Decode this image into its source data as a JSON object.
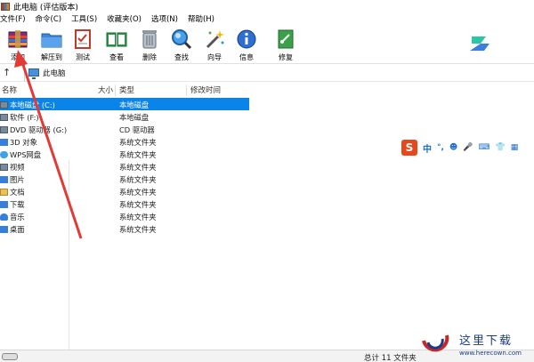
{
  "window": {
    "title": "此电脑 (评估版本)"
  },
  "menu": [
    "文件(F)",
    "命令(C)",
    "工具(S)",
    "收藏夹(O)",
    "选项(N)",
    "帮助(H)"
  ],
  "toolbar": {
    "add": "添加",
    "extract": "解压到",
    "test": "测试",
    "view": "查看",
    "delete": "删除",
    "find": "查找",
    "wizard": "向导",
    "info": "信息",
    "repair": "修复"
  },
  "address": {
    "path": "此电脑"
  },
  "columns": {
    "name": "名称",
    "size": "大小",
    "type": "类型",
    "modified": "修改时间"
  },
  "rows": [
    {
      "name": "本地磁盘 (C:)",
      "type": "本地磁盘",
      "icon": "drive-icon"
    },
    {
      "name": "软件 (F:)",
      "type": "本地磁盘",
      "icon": "drive-icon"
    },
    {
      "name": "DVD 驱动器 (G:)",
      "type": "CD 驱动器",
      "icon": "dvd-drive-icon"
    },
    {
      "name": "3D 对象",
      "type": "系统文件夹",
      "icon": "3d-objects-icon"
    },
    {
      "name": "WPS网盘",
      "type": "系统文件夹",
      "icon": "cloud-icon"
    },
    {
      "name": "视频",
      "type": "系统文件夹",
      "icon": "video-icon"
    },
    {
      "name": "图片",
      "type": "系统文件夹",
      "icon": "picture-icon"
    },
    {
      "name": "文档",
      "type": "系统文件夹",
      "icon": "document-icon"
    },
    {
      "name": "下载",
      "type": "系统文件夹",
      "icon": "download-icon"
    },
    {
      "name": "音乐",
      "type": "系统文件夹",
      "icon": "music-icon"
    },
    {
      "name": "桌面",
      "type": "系统文件夹",
      "icon": "desktop-icon"
    }
  ],
  "status": {
    "total": "总计 11 文件夹"
  },
  "ime": {
    "logo": "S",
    "lang": "中",
    "punct": "°,",
    "emoji": "☻",
    "mic": "🎤",
    "keyboard": "⌨",
    "shirt": "👕",
    "grid": "▦"
  },
  "watermark": {
    "title": "这里下载",
    "url": "www.herecown.com"
  },
  "colors": {
    "selection": "#0a84e8",
    "annotation_arrow": "#e53935"
  }
}
